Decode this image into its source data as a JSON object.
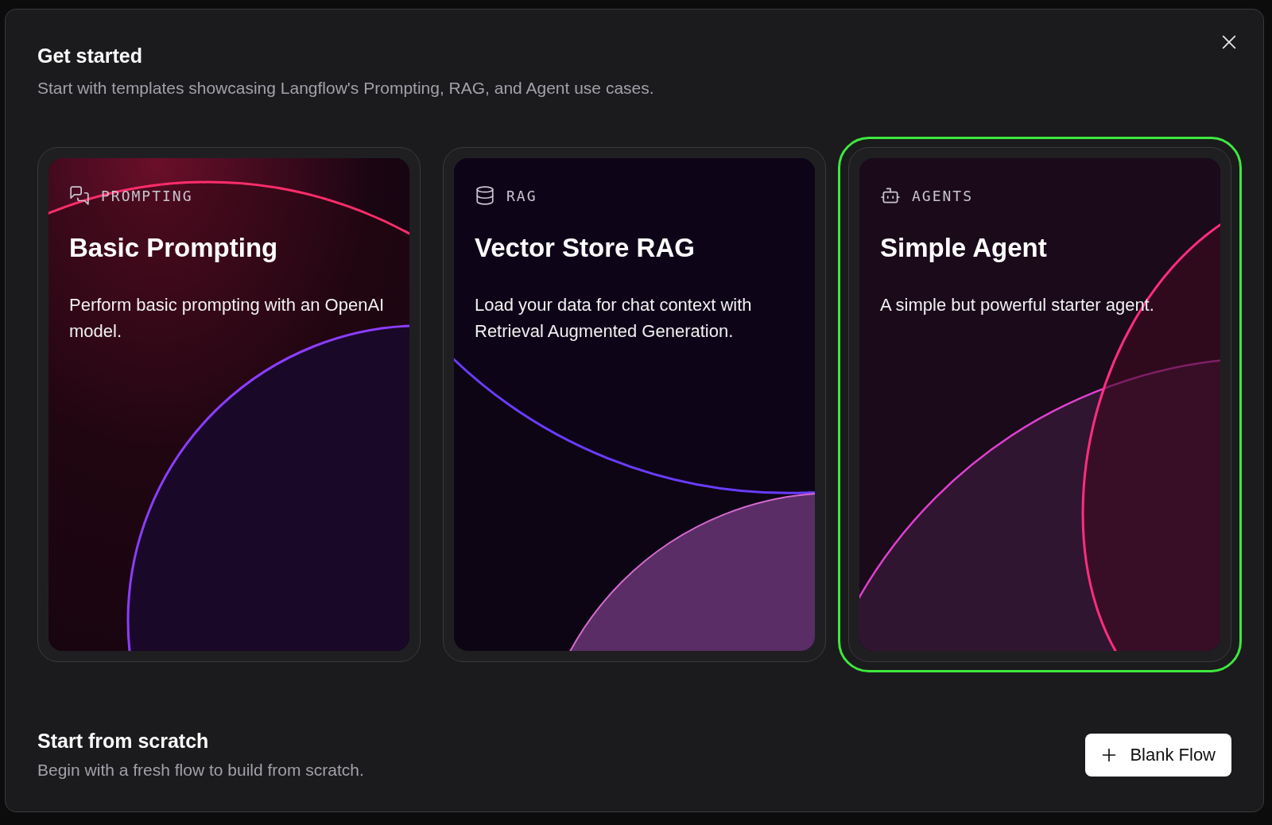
{
  "dialog": {
    "title": "Get started",
    "subtitle": "Start with templates showcasing Langflow's Prompting, RAG, and Agent use cases."
  },
  "templates": [
    {
      "kind": "prompting",
      "category": "PROMPTING",
      "title": "Basic Prompting",
      "description": "Perform basic prompting with an OpenAI model.",
      "selected": false
    },
    {
      "kind": "rag",
      "category": "RAG",
      "title": "Vector Store RAG",
      "description": "Load your data for chat context with Retrieval Augmented Generation.",
      "selected": false
    },
    {
      "kind": "agents",
      "category": "AGENTS",
      "title": "Simple Agent",
      "description": "A simple but powerful starter agent.",
      "selected": true
    }
  ],
  "scratch": {
    "title": "Start from scratch",
    "description": "Begin with a fresh flow to build from scratch.",
    "button": "Blank Flow"
  }
}
